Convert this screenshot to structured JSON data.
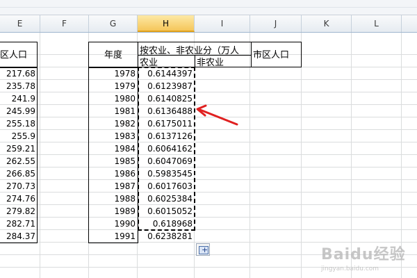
{
  "columns": [
    "E",
    "F",
    "G",
    "H",
    "I",
    "J",
    "K",
    "L"
  ],
  "selected_column": "H",
  "e_header": "区人口",
  "e_values": [
    "217.68",
    "235.78",
    "241.9",
    "245.99",
    "255.18",
    "255.9",
    "259.21",
    "262.55",
    "266.85",
    "270.73",
    "274.76",
    "279.82",
    "282.71",
    "284.37"
  ],
  "g_header": "年度",
  "years": [
    "1978",
    "1979",
    "1980",
    "1981",
    "1982",
    "1983",
    "1984",
    "1985",
    "1986",
    "1987",
    "1988",
    "1989",
    "1990",
    "1991"
  ],
  "h_header": "按农业、非农业分（万人",
  "h_sub_agri": "农业",
  "h_sub_nonagri": "非农业",
  "j_header": "市区人口",
  "h_values": [
    "0.6144397",
    "0.6123987",
    "0.6140825",
    "0.6136488",
    "0.6175011",
    "0.6137126",
    "0.6064162",
    "0.6047069",
    "0.5983545",
    "0.6017603",
    "0.6025384",
    "0.6015052",
    "0.618968",
    "0.6238281"
  ],
  "accent_arrow": "#e02020",
  "watermark": {
    "main": "Baidu经验",
    "sub": "jingyan.baidu.com"
  }
}
